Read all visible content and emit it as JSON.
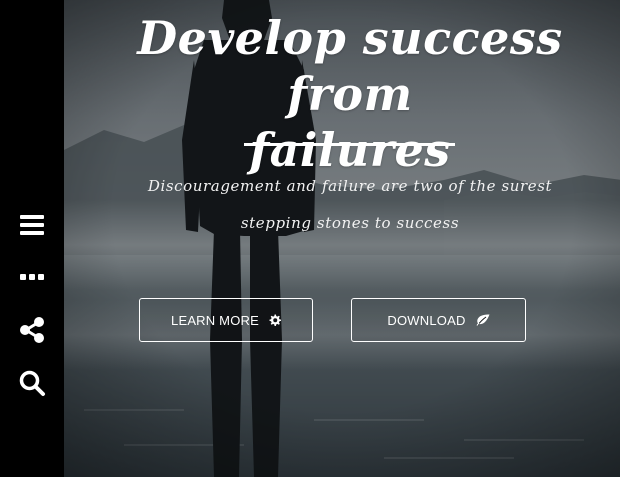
{
  "sidebar": {
    "items": [
      {
        "name": "menu",
        "icon": "menu-icon"
      },
      {
        "name": "more",
        "icon": "ellipsis-icon"
      },
      {
        "name": "share",
        "icon": "share-icon"
      },
      {
        "name": "search",
        "icon": "search-icon"
      }
    ]
  },
  "hero": {
    "title_line1": "Develop success from",
    "title_line2": "failures",
    "subtitle_line1": "Discouragement and failure are two of the surest",
    "subtitle_line2": "stepping stones to success",
    "buttons": {
      "learn_more": {
        "label": "LEARN MORE",
        "icon": "gear-icon"
      },
      "download": {
        "label": "DOWNLOAD",
        "icon": "leaf-icon"
      }
    }
  },
  "colors": {
    "sidebar_bg": "#000000",
    "text": "#ffffff"
  }
}
